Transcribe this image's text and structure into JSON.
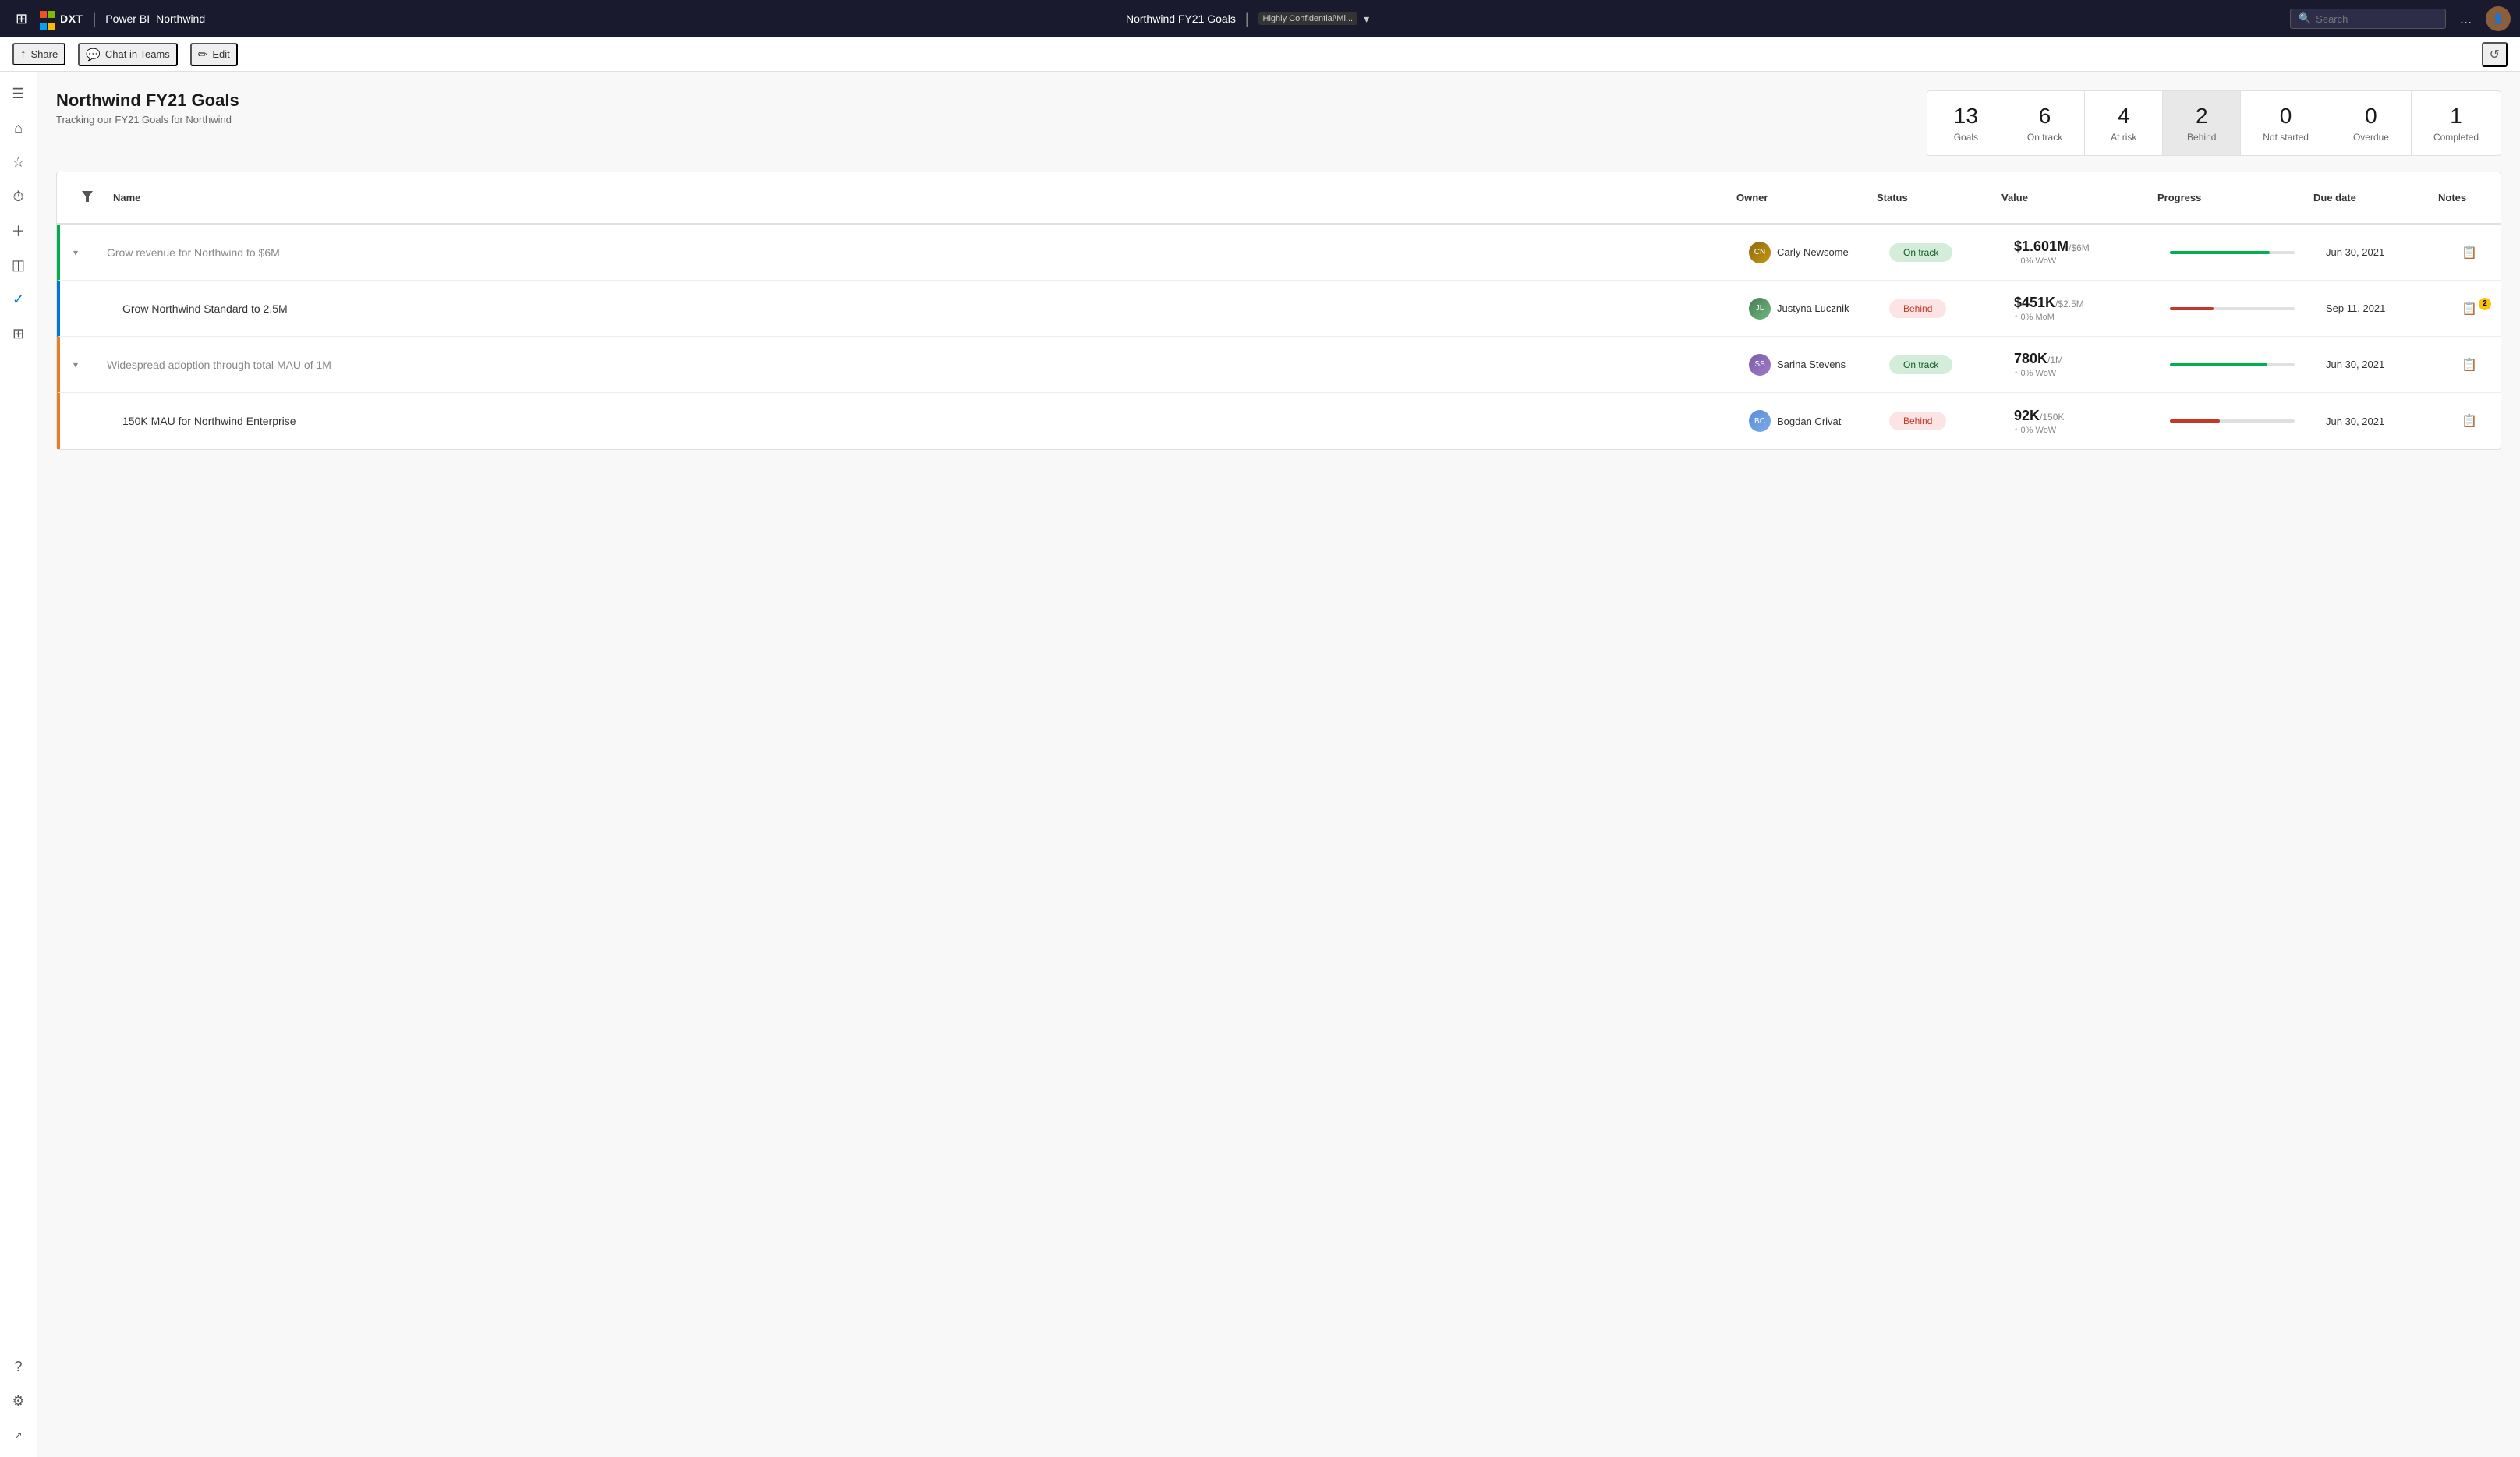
{
  "topNav": {
    "waffle": "⊞",
    "brand": "DXT",
    "powerbi": "Power BI",
    "separator": "|",
    "workspace": "Northwind",
    "reportTitle": "Northwind FY21 Goals",
    "badge": "Highly Confidential\\Mi...",
    "search": {
      "placeholder": "Search"
    },
    "more": "...",
    "refresh": "↺"
  },
  "secondNav": {
    "share": "Share",
    "chatInTeams": "Chat in Teams",
    "edit": "Edit"
  },
  "sidebar": {
    "items": [
      {
        "icon": "☰",
        "name": "menu"
      },
      {
        "icon": "⌂",
        "name": "home"
      },
      {
        "icon": "★",
        "name": "favorites"
      },
      {
        "icon": "⏱",
        "name": "recent"
      },
      {
        "icon": "＋",
        "name": "create"
      },
      {
        "icon": "◫",
        "name": "apps"
      },
      {
        "icon": "✓",
        "name": "goals"
      },
      {
        "icon": "⊞",
        "name": "workspaces"
      },
      {
        "icon": "⚙",
        "name": "settings-bottom"
      }
    ]
  },
  "scorecard": {
    "title": "Northwind FY21 Goals",
    "subtitle": "Tracking our FY21 Goals for Northwind",
    "metrics": [
      {
        "number": "13",
        "label": "Goals"
      },
      {
        "number": "6",
        "label": "On track"
      },
      {
        "number": "4",
        "label": "At risk"
      },
      {
        "number": "2",
        "label": "Behind",
        "active": true
      },
      {
        "number": "0",
        "label": "Not started"
      },
      {
        "number": "0",
        "label": "Overdue"
      },
      {
        "number": "1",
        "label": "Completed"
      }
    ]
  },
  "table": {
    "columns": [
      "",
      "Name",
      "Owner",
      "Status",
      "Value",
      "Progress",
      "Due date",
      "Notes"
    ],
    "filterLabel": "▼",
    "rows": [
      {
        "id": 1,
        "isParent": true,
        "expanded": true,
        "indent": false,
        "accent": "green",
        "name": "Grow revenue for Northwind to $6M",
        "owner": {
          "name": "Carly Newsome",
          "avatarClass": "av-carly",
          "initials": "CN"
        },
        "status": "On track",
        "statusClass": "status-on-track",
        "valueMain": "$1.601M",
        "valueSub": "/$6M",
        "valueChange": "↑ 0% WoW",
        "progressPct": 80,
        "progressClass": "progress-green",
        "dueDate": "Jun 30, 2021",
        "hasNotes": false,
        "notesCount": 0
      },
      {
        "id": 2,
        "isParent": false,
        "expanded": false,
        "indent": true,
        "accent": "blue",
        "name": "Grow Northwind Standard to 2.5M",
        "owner": {
          "name": "Justyna Lucznik",
          "avatarClass": "av-justyna",
          "initials": "JL"
        },
        "status": "Behind",
        "statusClass": "status-behind",
        "valueMain": "$451K",
        "valueSub": "/$2.5M",
        "valueChange": "↑ 0% MoM",
        "progressPct": 35,
        "progressClass": "progress-red",
        "dueDate": "Sep 11, 2021",
        "hasNotes": true,
        "notesCount": 2
      },
      {
        "id": 3,
        "isParent": true,
        "expanded": true,
        "indent": false,
        "accent": "orange",
        "name": "Widespread adoption through total MAU of 1M",
        "owner": {
          "name": "Sarina Stevens",
          "avatarClass": "av-sarina",
          "initials": "SS"
        },
        "status": "On track",
        "statusClass": "status-on-track",
        "valueMain": "780K",
        "valueSub": "/1M",
        "valueChange": "↑ 0% WoW",
        "progressPct": 78,
        "progressClass": "progress-green",
        "dueDate": "Jun 30, 2021",
        "hasNotes": false,
        "notesCount": 0
      },
      {
        "id": 4,
        "isParent": false,
        "expanded": false,
        "indent": true,
        "accent": "orange",
        "name": "150K MAU for Northwind Enterprise",
        "owner": {
          "name": "Bogdan Crivat",
          "avatarClass": "av-bogdan",
          "initials": "BC"
        },
        "status": "Behind",
        "statusClass": "status-behind",
        "valueMain": "92K",
        "valueSub": "/150K",
        "valueChange": "↑ 0% WoW",
        "progressPct": 40,
        "progressClass": "progress-red",
        "dueDate": "Jun 30, 2021",
        "hasNotes": false,
        "notesCount": 0
      }
    ]
  }
}
